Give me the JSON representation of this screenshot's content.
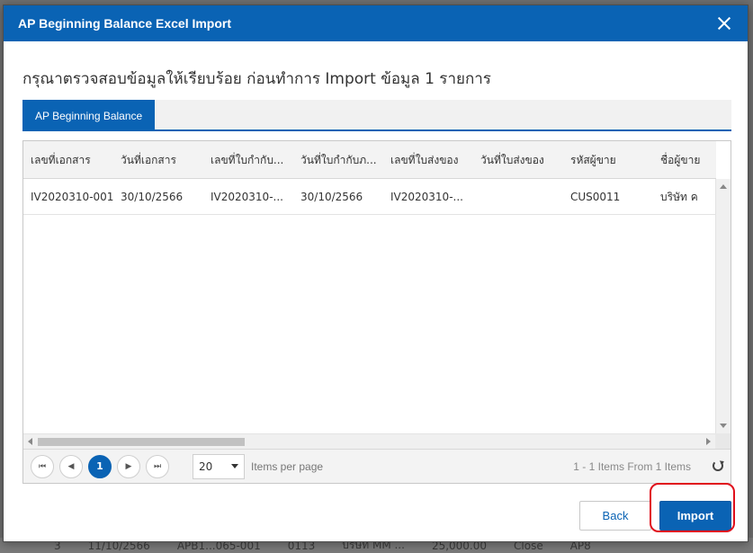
{
  "background": {
    "row_fragments": [
      "3",
      "11/10/2566",
      "APB1...065-001",
      "0113",
      "บริษัท MM ...",
      "25,000.00",
      "Close",
      "AP8"
    ]
  },
  "dialog": {
    "title": "AP Beginning Balance Excel Import",
    "message": "กรุณาตรวจสอบข้อมูลให้เรียบร้อย ก่อนทำการ Import ข้อมูล 1 รายการ",
    "tabs": [
      {
        "label": "AP Beginning Balance",
        "active": true
      }
    ],
    "grid": {
      "columns": [
        "เลขที่เอกสาร",
        "วันที่เอกสาร",
        "เลขที่ใบกำกับ...",
        "วันที่ใบกำกับภ...",
        "เลขที่ใบส่งของ",
        "วันที่ใบส่งของ",
        "รหัสผู้ขาย",
        "ชื่อผู้ขาย"
      ],
      "rows": [
        [
          "IV2020310-001",
          "30/10/2566",
          "IV2020310-...",
          "30/10/2566",
          "IV2020310-...",
          "",
          "CUS0011",
          "บริษัท ค"
        ]
      ]
    },
    "pager": {
      "first": "⏮",
      "prev": "◀",
      "current_page": "1",
      "next": "▶",
      "last": "⏭",
      "page_size": "20",
      "items_per_page_label": "Items per page",
      "info": "1 - 1 Items From 1 Items"
    },
    "buttons": {
      "back_label": "Back",
      "import_label": "Import"
    },
    "accent_color": "#0a63b4",
    "highlight_color": "#e0101c"
  }
}
